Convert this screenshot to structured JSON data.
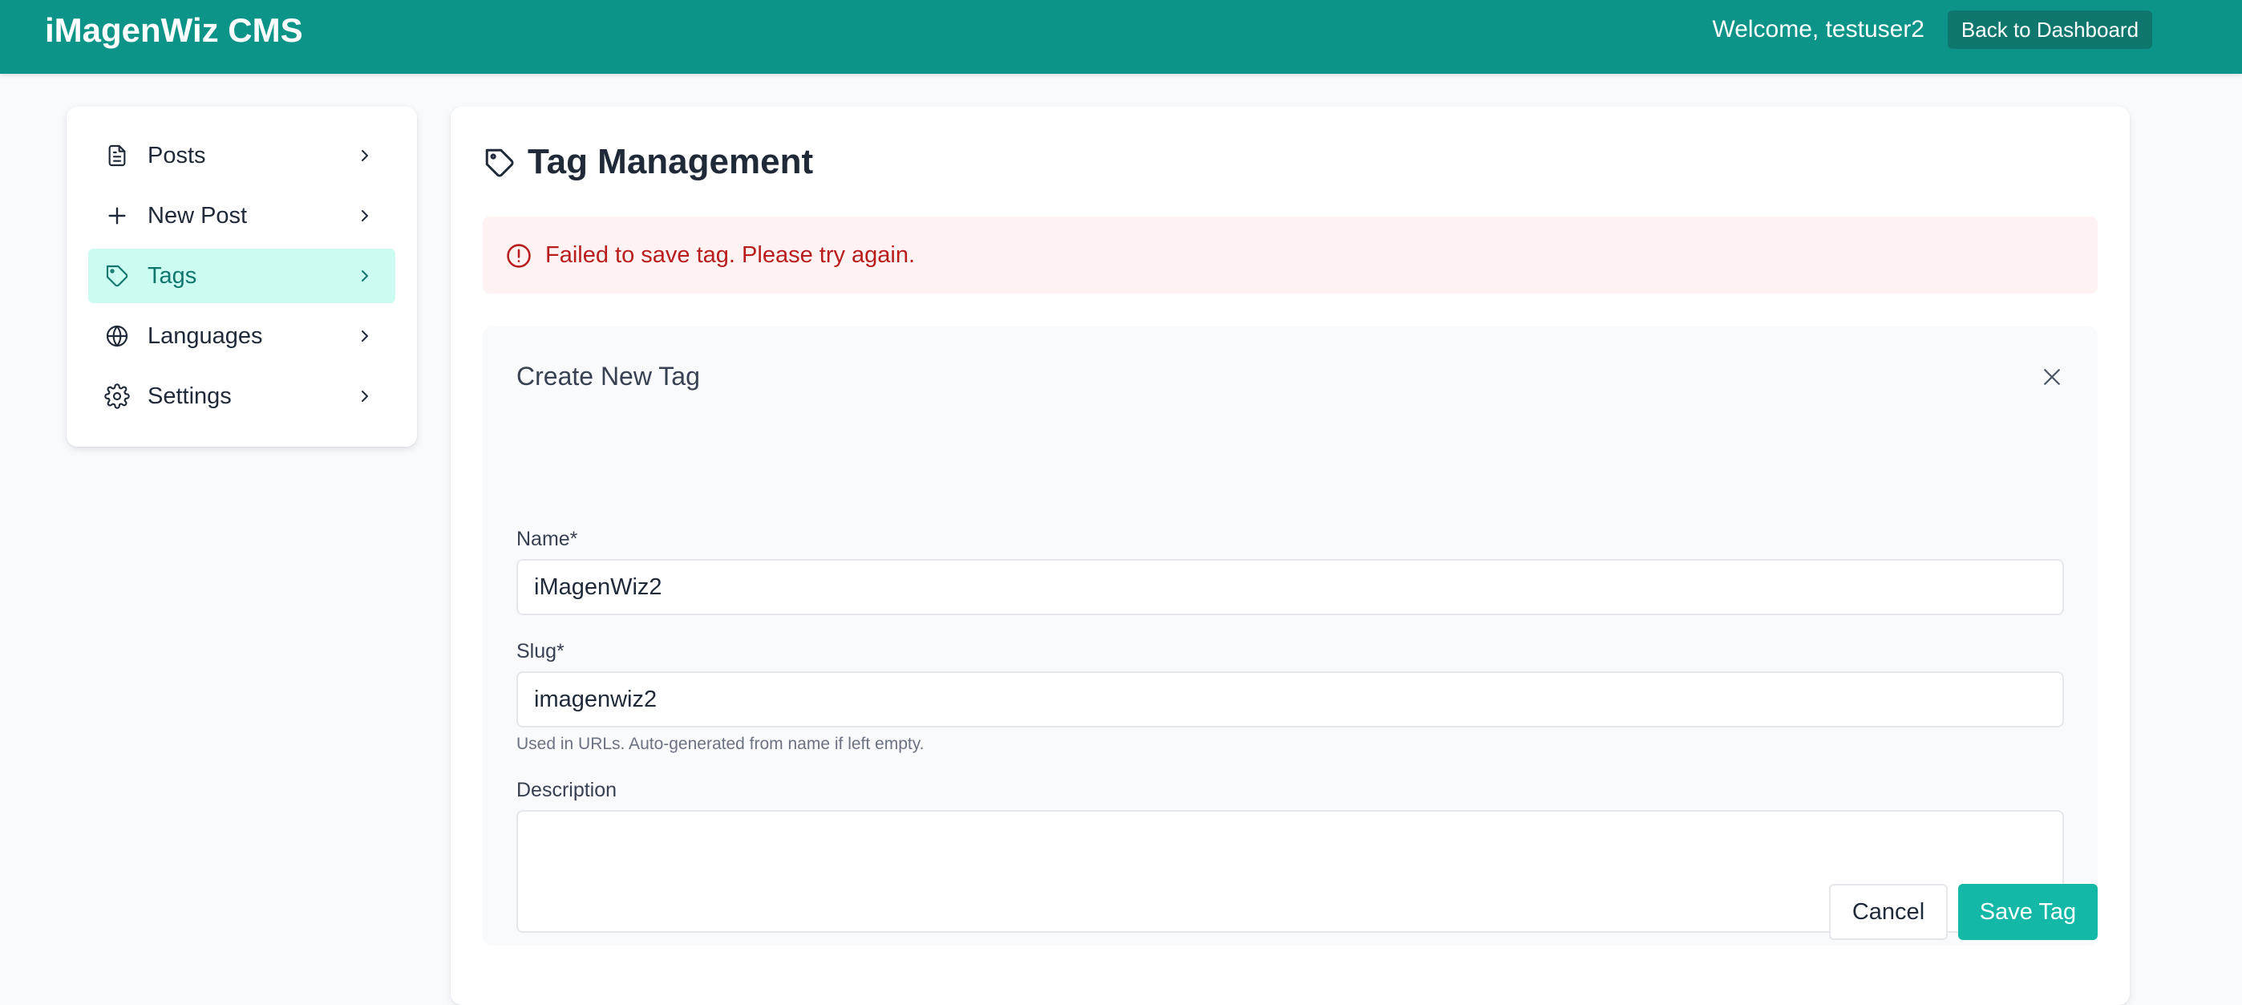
{
  "header": {
    "brand": "iMagenWiz CMS",
    "welcome": "Welcome, testuser2",
    "back_button": "Back to Dashboard"
  },
  "sidebar": {
    "items": [
      {
        "label": "Posts",
        "icon": "document-icon",
        "active": false
      },
      {
        "label": "New Post",
        "icon": "plus-icon",
        "active": false
      },
      {
        "label": "Tags",
        "icon": "tag-icon",
        "active": true
      },
      {
        "label": "Languages",
        "icon": "globe-icon",
        "active": false
      },
      {
        "label": "Settings",
        "icon": "gear-icon",
        "active": false
      }
    ]
  },
  "main": {
    "title": "Tag Management",
    "title_icon": "tag-icon",
    "error_message": "Failed to save tag. Please try again.",
    "form": {
      "title": "Create New Tag",
      "name_label": "Name*",
      "name_value": "iMagenWiz2",
      "slug_label": "Slug*",
      "slug_value": "imagenwiz2",
      "slug_hint": "Used in URLs. Auto-generated from name if left empty.",
      "description_label": "Description",
      "description_value": "",
      "cancel_label": "Cancel",
      "save_label": "Save Tag"
    }
  },
  "colors": {
    "header_bg": "#0d9488",
    "back_button_bg": "#0f766e",
    "active_nav_bg": "#ccfbf1",
    "active_nav_text": "#0f766e",
    "alert_bg": "#fef2f2",
    "alert_text": "#b91c1c",
    "save_button_bg": "#14b8a6",
    "page_bg": "#f8fafc"
  }
}
